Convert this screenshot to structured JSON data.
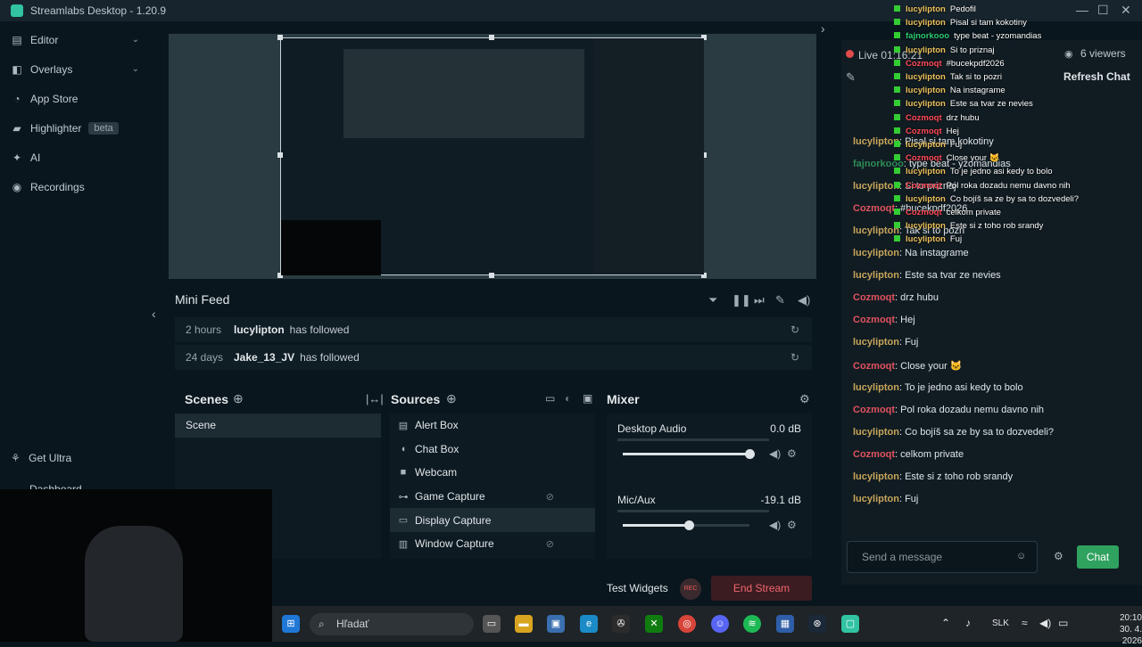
{
  "app": {
    "title": "Streamlabs Desktop - 1.20.9",
    "accent": "#31c3a2"
  },
  "sidebar": {
    "items": [
      {
        "label": "Editor",
        "icon": "editor-icon",
        "chevron": "⌄"
      },
      {
        "label": "Overlays",
        "icon": "overlays-icon",
        "chevron": "⌄"
      },
      {
        "label": "App Store",
        "icon": "app-store-icon"
      },
      {
        "label": "Highlighter",
        "icon": "highlighter-icon",
        "badge": "beta"
      },
      {
        "label": "AI",
        "icon": "ai-icon"
      },
      {
        "label": "Recordings",
        "icon": "recordings-icon"
      }
    ],
    "get_ultra": "Get Ultra",
    "dashboard": "Dashboard"
  },
  "minifeed": {
    "title": "Mini Feed",
    "rows": [
      {
        "time": "2 hours",
        "user": "lucylipton",
        "action": "has followed"
      },
      {
        "time": "24 days",
        "user": "Jake_13_JV",
        "action": "has followed"
      }
    ]
  },
  "scenes": {
    "title": "Scenes",
    "items": [
      "Scene"
    ]
  },
  "sources": {
    "title": "Sources",
    "items": [
      {
        "label": "Alert Box",
        "icon": "alert-box-icon",
        "hidden": false,
        "selected": false
      },
      {
        "label": "Chat Box",
        "icon": "chat-box-icon",
        "hidden": false,
        "selected": false
      },
      {
        "label": "Webcam",
        "icon": "webcam-icon",
        "hidden": false,
        "selected": false
      },
      {
        "label": "Game Capture",
        "icon": "gamepad-icon",
        "hidden": true,
        "selected": false
      },
      {
        "label": "Display Capture",
        "icon": "monitor-icon",
        "hidden": false,
        "selected": true
      },
      {
        "label": "Window Capture",
        "icon": "window-icon",
        "hidden": true,
        "selected": false
      }
    ]
  },
  "mixer": {
    "title": "Mixer",
    "channels": [
      {
        "name": "Desktop Audio",
        "db": "0.0 dB",
        "level": 1.0
      },
      {
        "name": "Mic/Aux",
        "db": "-19.1 dB",
        "level": 0.52
      }
    ]
  },
  "footer": {
    "test_widgets": "Test Widgets",
    "rec": "REC",
    "end_stream": "End Stream"
  },
  "chat": {
    "status": "Live 01:16:21",
    "viewers": "6 viewers",
    "refresh": "Refresh Chat",
    "messages": [
      {
        "user": "lucylipton",
        "text": "Pedofil",
        "color": "lucy"
      },
      {
        "user": "lucylipton",
        "text": "Pisal si tam kokotiny",
        "color": "lucy"
      },
      {
        "user": "fajnorkooo",
        "text": "type beat - yzomandias",
        "color": "faj"
      },
      {
        "user": "lucylipton",
        "text": "Si to priznaj",
        "color": "lucy"
      },
      {
        "user": "Cozmoqt",
        "text": "#bucekpdf2026",
        "color": "coz"
      },
      {
        "user": "lucylipton",
        "text": "Tak si to pozri",
        "color": "lucy"
      },
      {
        "user": "lucylipton",
        "text": "Na instagrame",
        "color": "lucy"
      },
      {
        "user": "lucylipton",
        "text": "Este sa tvar ze nevies",
        "color": "lucy"
      },
      {
        "user": "Cozmoqt",
        "text": "drz hubu",
        "color": "coz"
      },
      {
        "user": "Cozmoqt",
        "text": "Hej",
        "color": "coz"
      },
      {
        "user": "lucylipton",
        "text": "Fuj",
        "color": "lucy"
      },
      {
        "user": "Cozmoqt",
        "text": "Close your 🐱",
        "color": "coz"
      },
      {
        "user": "lucylipton",
        "text": "To je jedno asi kedy to bolo",
        "color": "lucy"
      },
      {
        "user": "Cozmoqt",
        "text": "Pol roka dozadu nemu davno nih",
        "color": "coz"
      },
      {
        "user": "lucylipton",
        "text": "Co bojíš sa ze by sa to dozvedeli?",
        "color": "lucy"
      },
      {
        "user": "Cozmoqt",
        "text": "celkom private",
        "color": "coz"
      },
      {
        "user": "lucylipton",
        "text": "Este si z toho rob srandy",
        "color": "lucy"
      },
      {
        "user": "lucylipton",
        "text": "Fuj",
        "color": "lucy"
      }
    ],
    "placeholder": "Send a message",
    "send": "Chat"
  },
  "taskbar": {
    "search_placeholder": "Hľadať",
    "lang": "SLK",
    "time": "20:10",
    "date": "30. 4. 2026"
  }
}
